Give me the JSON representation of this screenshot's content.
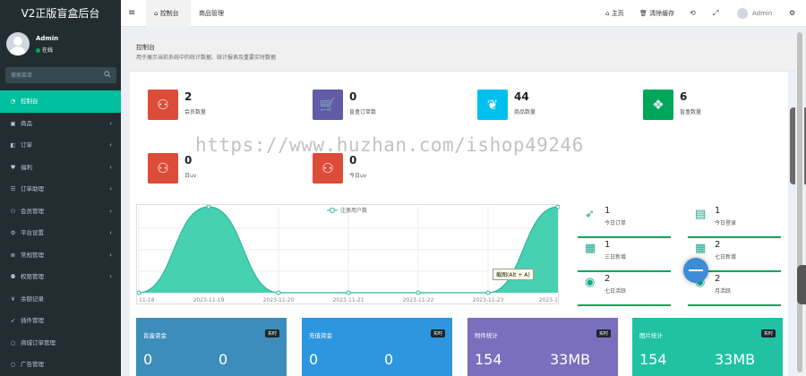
{
  "brand": "V2正版盲盒后台",
  "user": {
    "name": "Admin",
    "status": "在线"
  },
  "sidebar_search": {
    "placeholder": "搜索菜单"
  },
  "menu": [
    {
      "label": "控制台",
      "icon": "dashboard-icon",
      "active": true,
      "arrow": ""
    },
    {
      "label": "商品",
      "icon": "shopping-bag-icon",
      "arrow": "‹"
    },
    {
      "label": "订单",
      "icon": "box-icon",
      "arrow": "‹"
    },
    {
      "label": "福利",
      "icon": "heart-icon",
      "arrow": "‹"
    },
    {
      "label": "订单助理",
      "icon": "list-icon",
      "arrow": "‹"
    },
    {
      "label": "会员管理",
      "icon": "users-icon",
      "arrow": "‹"
    },
    {
      "label": "平台设置",
      "icon": "gear-icon",
      "arrow": "‹"
    },
    {
      "label": "常规管理",
      "icon": "database-icon",
      "arrow": "‹"
    },
    {
      "label": "权限管理",
      "icon": "group-icon",
      "arrow": "‹"
    },
    {
      "label": "余额记录",
      "icon": "yen-icon",
      "arrow": ""
    },
    {
      "label": "插件管理",
      "icon": "rocket-icon",
      "arrow": ""
    },
    {
      "label": "商城订单管理",
      "icon": "circle-icon",
      "arrow": ""
    },
    {
      "label": "广告管理",
      "icon": "circle-icon",
      "arrow": ""
    }
  ],
  "topbar": {
    "tabs": [
      {
        "label": "控制台"
      },
      {
        "label": "商品管理"
      }
    ],
    "home": "主页",
    "clear_cache": "清除缓存",
    "admin": "Admin"
  },
  "panel": {
    "title": "控制台",
    "subtitle": "用于展示当前系统中的统计数据、统计报表及重要实时数据"
  },
  "stats": [
    {
      "value": "2",
      "label": "会员数量",
      "color": "#dd4b39",
      "icon": "users-icon"
    },
    {
      "value": "0",
      "label": "盲盒订单数",
      "color": "#605ca8",
      "icon": "cart-icon"
    },
    {
      "value": "44",
      "label": "商品数量",
      "color": "#00c0ef",
      "icon": "leaf-icon"
    },
    {
      "value": "6",
      "label": "盲盒数量",
      "color": "#00a65a",
      "icon": "dropbox-icon"
    },
    {
      "value": "0",
      "label": "日uv",
      "color": "#dd4b39",
      "icon": "users-icon"
    },
    {
      "value": "0",
      "label": "今日uv",
      "color": "#dd4b39",
      "icon": "users-icon"
    }
  ],
  "chart_data": {
    "type": "area",
    "legend": "注册用户数",
    "x": [
      "11-18",
      "2023-11-19",
      "2023-11-20",
      "2023-11-21",
      "2023-11-22",
      "2023-11-23",
      "2023-1"
    ],
    "values": [
      0,
      2,
      0,
      0,
      0,
      0,
      2
    ],
    "ylim": [
      0,
      2
    ],
    "grid": true,
    "color": "#48d1b0"
  },
  "mini_stats": [
    {
      "value": "1",
      "label": "今日订单",
      "icon": "rocket-icon"
    },
    {
      "value": "1",
      "label": "今日登录",
      "icon": "id-card-icon"
    },
    {
      "value": "1",
      "label": "三日新增",
      "icon": "calendar-icon"
    },
    {
      "value": "2",
      "label": "七日新增",
      "icon": "calendar-plus-icon"
    },
    {
      "value": "2",
      "label": "七日活跃",
      "icon": "user-circle-icon"
    },
    {
      "value": "2",
      "label": "月活跃",
      "icon": "user-circle-icon"
    }
  ],
  "cards": [
    {
      "title": "盲盒资金",
      "badge": "实时",
      "v1": "0",
      "v2": "0",
      "color": "#3c8dbc"
    },
    {
      "title": "充值资金",
      "badge": "实时",
      "v1": "0",
      "v2": "0",
      "color": "#2c97de"
    },
    {
      "title": "附件统计",
      "badge": "实时",
      "v1": "154",
      "v2": "33MB",
      "color": "#7a6fbe"
    },
    {
      "title": "图片统计",
      "badge": "实时",
      "v1": "154",
      "v2": "33MB",
      "color": "#21c2a4"
    }
  ],
  "watermark": "https://www.huzhan.com/ishop49246",
  "tooltip": "截图(Alt + A)"
}
